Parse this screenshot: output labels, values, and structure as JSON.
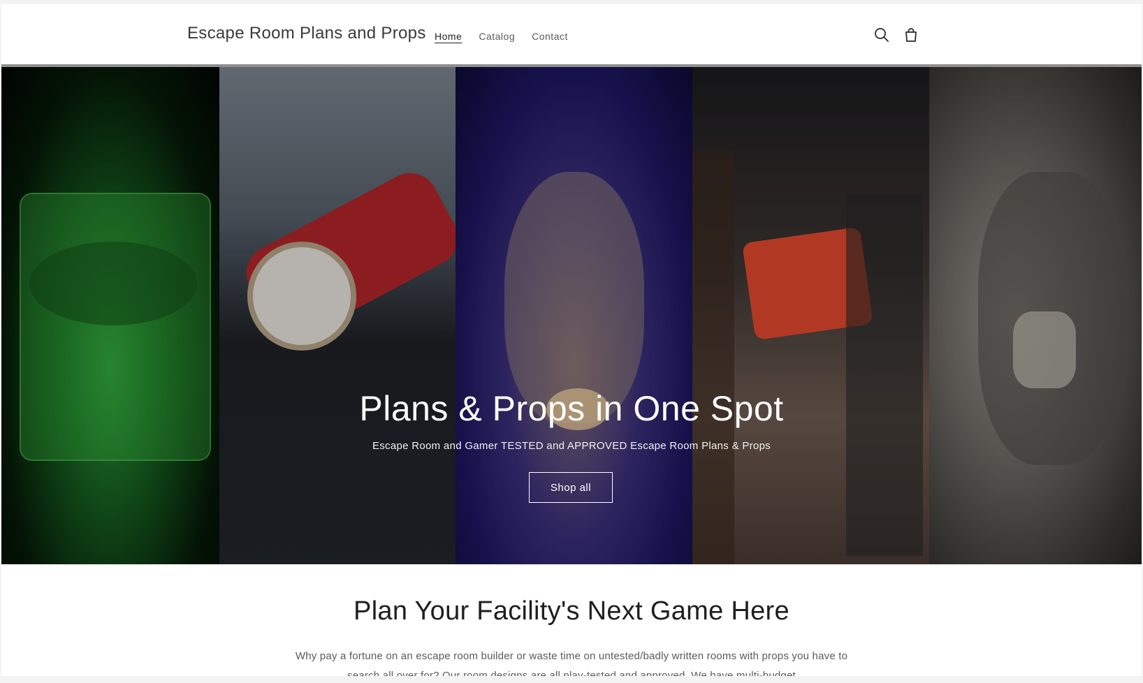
{
  "header": {
    "brand": "Escape Room Plans and Props",
    "nav": [
      {
        "label": "Home",
        "active": true
      },
      {
        "label": "Catalog",
        "active": false
      },
      {
        "label": "Contact",
        "active": false
      }
    ],
    "icons": [
      "search-icon",
      "cart-icon"
    ]
  },
  "hero": {
    "title": "Plans & Props in One Spot",
    "subtitle": "Escape Room and Gamer TESTED and APPROVED Escape Room Plans & Props",
    "button_label": "Shop all"
  },
  "section": {
    "title": "Plan Your Facility's Next Game Here",
    "text": "Why pay a fortune on an escape room builder or waste time on untested/badly written rooms with props you have to search all over for? Our room designs are all play-tested and approved. We have multi-budget"
  },
  "colors": {
    "text_dark": "#1f1f1f",
    "text_muted": "#5a5a5a",
    "button_border": "#ffffff"
  }
}
